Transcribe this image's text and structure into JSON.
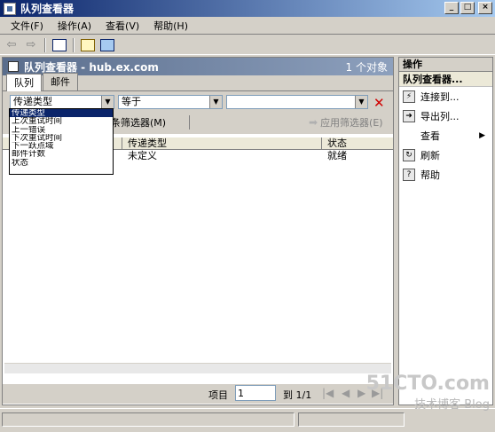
{
  "window": {
    "title": "队列查看器",
    "min": "_",
    "max": "□",
    "close": "×"
  },
  "menu": [
    "文件(F)",
    "操作(A)",
    "查看(V)",
    "帮助(H)"
  ],
  "toolbar": {
    "back": "⇦",
    "forward": "⇨"
  },
  "main": {
    "header_title": "队列查看器 - hub.ex.com",
    "header_count": "1 个对象",
    "tabs": [
      "队列",
      "邮件"
    ]
  },
  "filter": {
    "field": "传递类型",
    "operator": "等于",
    "value": "",
    "create_filter": "条筛选器(M)",
    "apply_filter": "应用筛选器(E)"
  },
  "dropdown": {
    "options": [
      "传递类型",
      "上次重试时间",
      "上一错误",
      "下次重试时间",
      "下一跃点域",
      "邮件计数",
      "状态"
    ],
    "selected_index": 0
  },
  "grid": {
    "columns": [
      "",
      "传递类型",
      "状态"
    ],
    "rows": [
      [
        "",
        "未定义",
        "就绪"
      ]
    ]
  },
  "pager": {
    "label_item": "项目",
    "current": "1",
    "label_of": "到 1/1",
    "nav_first": "|◀",
    "nav_prev": "◀",
    "nav_next": "▶",
    "nav_last": "▶|"
  },
  "actions": {
    "title": "操作",
    "subtitle": "队列查看器...",
    "items": [
      {
        "label": "连接到...",
        "icon": "connect-icon"
      },
      {
        "label": "导出列...",
        "icon": "export-icon"
      },
      {
        "label": "查看",
        "icon": ""
      },
      {
        "label": "刷新",
        "icon": "refresh-icon"
      },
      {
        "label": "帮助",
        "icon": "help-icon"
      }
    ]
  },
  "watermark": {
    "top": "51CTO.com",
    "bottom": "技术博客  Blog"
  }
}
